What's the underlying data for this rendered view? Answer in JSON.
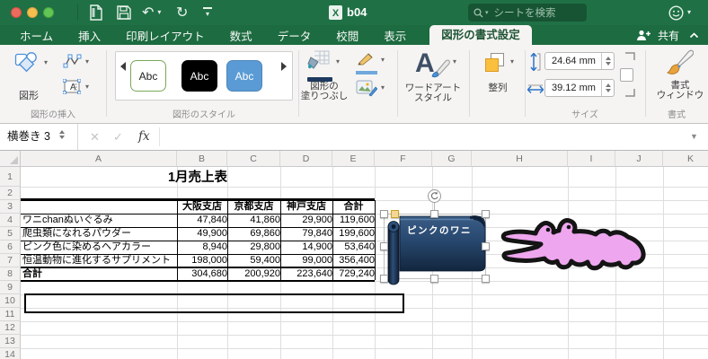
{
  "window": {
    "title": "b04",
    "search_placeholder": "シートを検索"
  },
  "tabs": {
    "items": [
      "ホーム",
      "挿入",
      "印刷レイアウト",
      "数式",
      "データ",
      "校閲",
      "表示"
    ],
    "active": "図形の書式設定",
    "share_label": "共有"
  },
  "ribbon": {
    "insert_shapes": {
      "shapes_label": "図形",
      "group_label": "図形の挿入"
    },
    "shape_styles": {
      "chips": [
        "Abc",
        "Abc",
        "Abc"
      ],
      "group_label": "図形のスタイル"
    },
    "shape_fill": {
      "line1": "図形の",
      "line2": "塗りつぶし"
    },
    "wordart": {
      "letter": "A",
      "line1": "ワードアート",
      "line2": "スタイル"
    },
    "arrange": {
      "label": "整列"
    },
    "size": {
      "height_value": "24.64 mm",
      "width_value": "39.12 mm",
      "group_label": "サイズ"
    },
    "format_pane": {
      "line1": "書式",
      "line2": "ウィンドウ",
      "group_label": "書式"
    }
  },
  "formula_bar": {
    "name_box_value": "横巻き 3",
    "fx_label": "fx",
    "cancel": "✕",
    "enter": "✓"
  },
  "grid": {
    "col_letters": [
      "A",
      "B",
      "C",
      "D",
      "E",
      "F",
      "G",
      "H",
      "I",
      "J",
      "K"
    ],
    "row_numbers": [
      "1",
      "2",
      "3",
      "4",
      "5",
      "6",
      "7",
      "8",
      "9",
      "10",
      "11",
      "12",
      "13",
      "14"
    ]
  },
  "sheet": {
    "title": "1月売上表",
    "table": {
      "headers": [
        "大阪支店",
        "京都支店",
        "神戸支店",
        "合計"
      ],
      "rows": [
        {
          "label": "ワニchanぬいぐるみ",
          "values": [
            "47,840",
            "41,860",
            "29,900",
            "119,600"
          ]
        },
        {
          "label": "爬虫類になれるパウダー",
          "values": [
            "49,900",
            "69,860",
            "79,840",
            "199,600"
          ]
        },
        {
          "label": "ピンク色に染めるヘアカラー",
          "values": [
            "8,940",
            "29,800",
            "14,900",
            "53,640"
          ]
        },
        {
          "label": "恒温動物に進化するサプリメント",
          "values": [
            "198,000",
            "59,400",
            "99,000",
            "356,400"
          ]
        }
      ],
      "total": {
        "label": "合計",
        "values": [
          "304,680",
          "200,920",
          "223,640",
          "729,240"
        ]
      }
    },
    "scroll_shape_text": "ピンクのワニ"
  },
  "colors": {
    "excel_green": "#1f7145",
    "scroll_navy": "#24446b",
    "croc_pink": "#eea6ee"
  }
}
